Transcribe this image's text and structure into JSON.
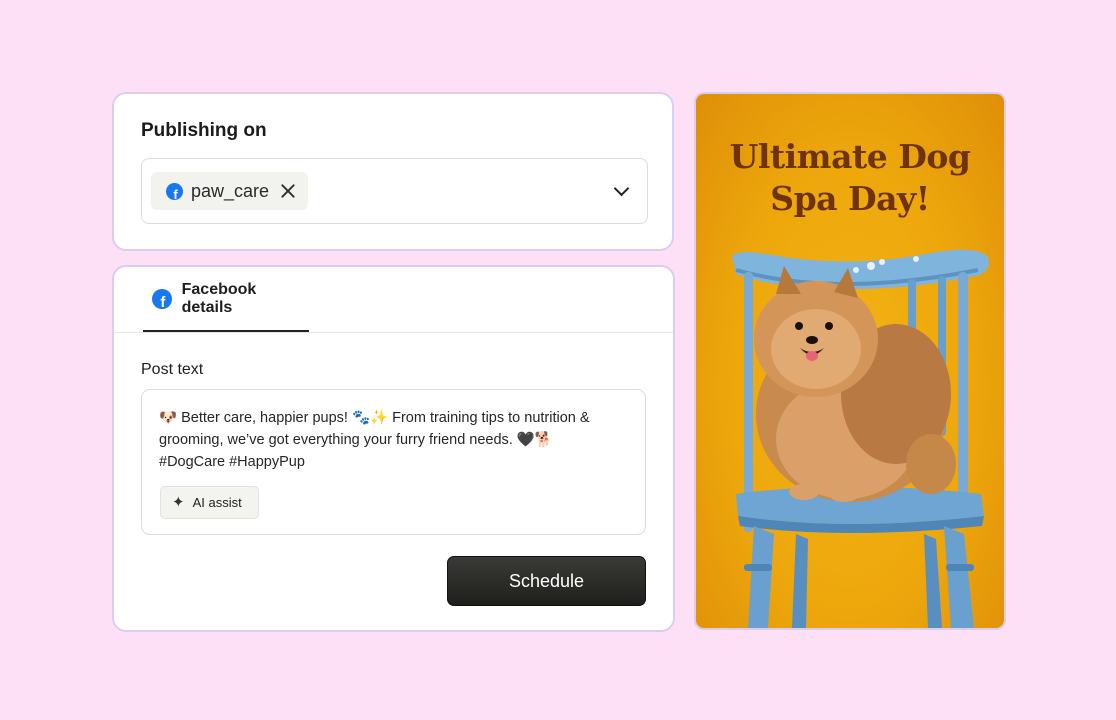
{
  "publishing": {
    "title": "Publishing on",
    "account_chip": {
      "label": "paw_care",
      "icon": "facebook-icon"
    },
    "dropdown_icon": "chevron-down-icon"
  },
  "details": {
    "tab_label": "Facebook details",
    "post_label": "Post text",
    "post_text": "🐶 Better care, happier pups! 🐾✨ From training tips to nutrition & grooming, we’ve got everything your furry friend needs. 🖤🐕\n#DogCare #HappyPup",
    "ai_assist_label": "AI assist",
    "schedule_label": "Schedule"
  },
  "preview": {
    "title": "Ultimate Dog Spa Day!",
    "image": "pomeranian-on-blue-chair"
  },
  "colors": {
    "background": "#fde0f5",
    "facebook": "#1877f2",
    "preview_bg": "#eda70c",
    "preview_title": "#6e3307",
    "schedule_button": "#262623"
  }
}
